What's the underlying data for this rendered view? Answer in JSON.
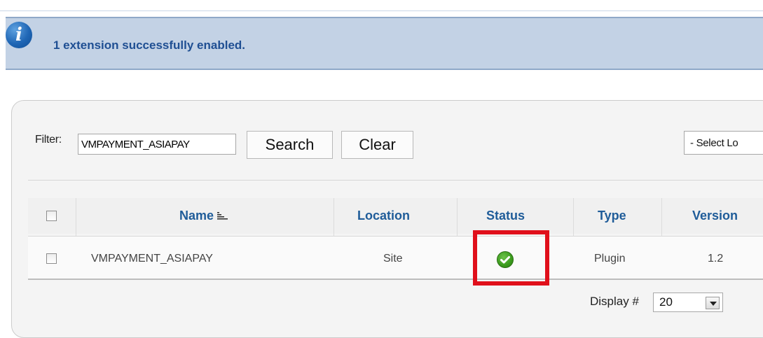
{
  "message": {
    "icon": "info-icon",
    "icon_glyph": "i",
    "text": "1 extension successfully enabled.",
    "color": "#1f4f93",
    "background": "#c3d2e5"
  },
  "filter": {
    "label": "Filter:",
    "value": "VMPAYMENT_ASIAPAY",
    "search_label": "Search",
    "clear_label": "Clear",
    "location_select": "- Select Lo"
  },
  "table": {
    "headers": {
      "name": "Name",
      "location": "Location",
      "status": "Status",
      "type": "Type",
      "version": "Version"
    },
    "sort_icon": "sort-ascending-icon",
    "rows": [
      {
        "name": "VMPAYMENT_ASIAPAY",
        "location": "Site",
        "status": "enabled",
        "status_icon": "green-check-icon",
        "type": "Plugin",
        "version": "1.2"
      }
    ]
  },
  "footer": {
    "display_label": "Display #",
    "display_value": "20"
  },
  "colors": {
    "header_link": "#1f5c99",
    "highlight": "#e0101b",
    "status_ok": "#3a9a1c"
  }
}
